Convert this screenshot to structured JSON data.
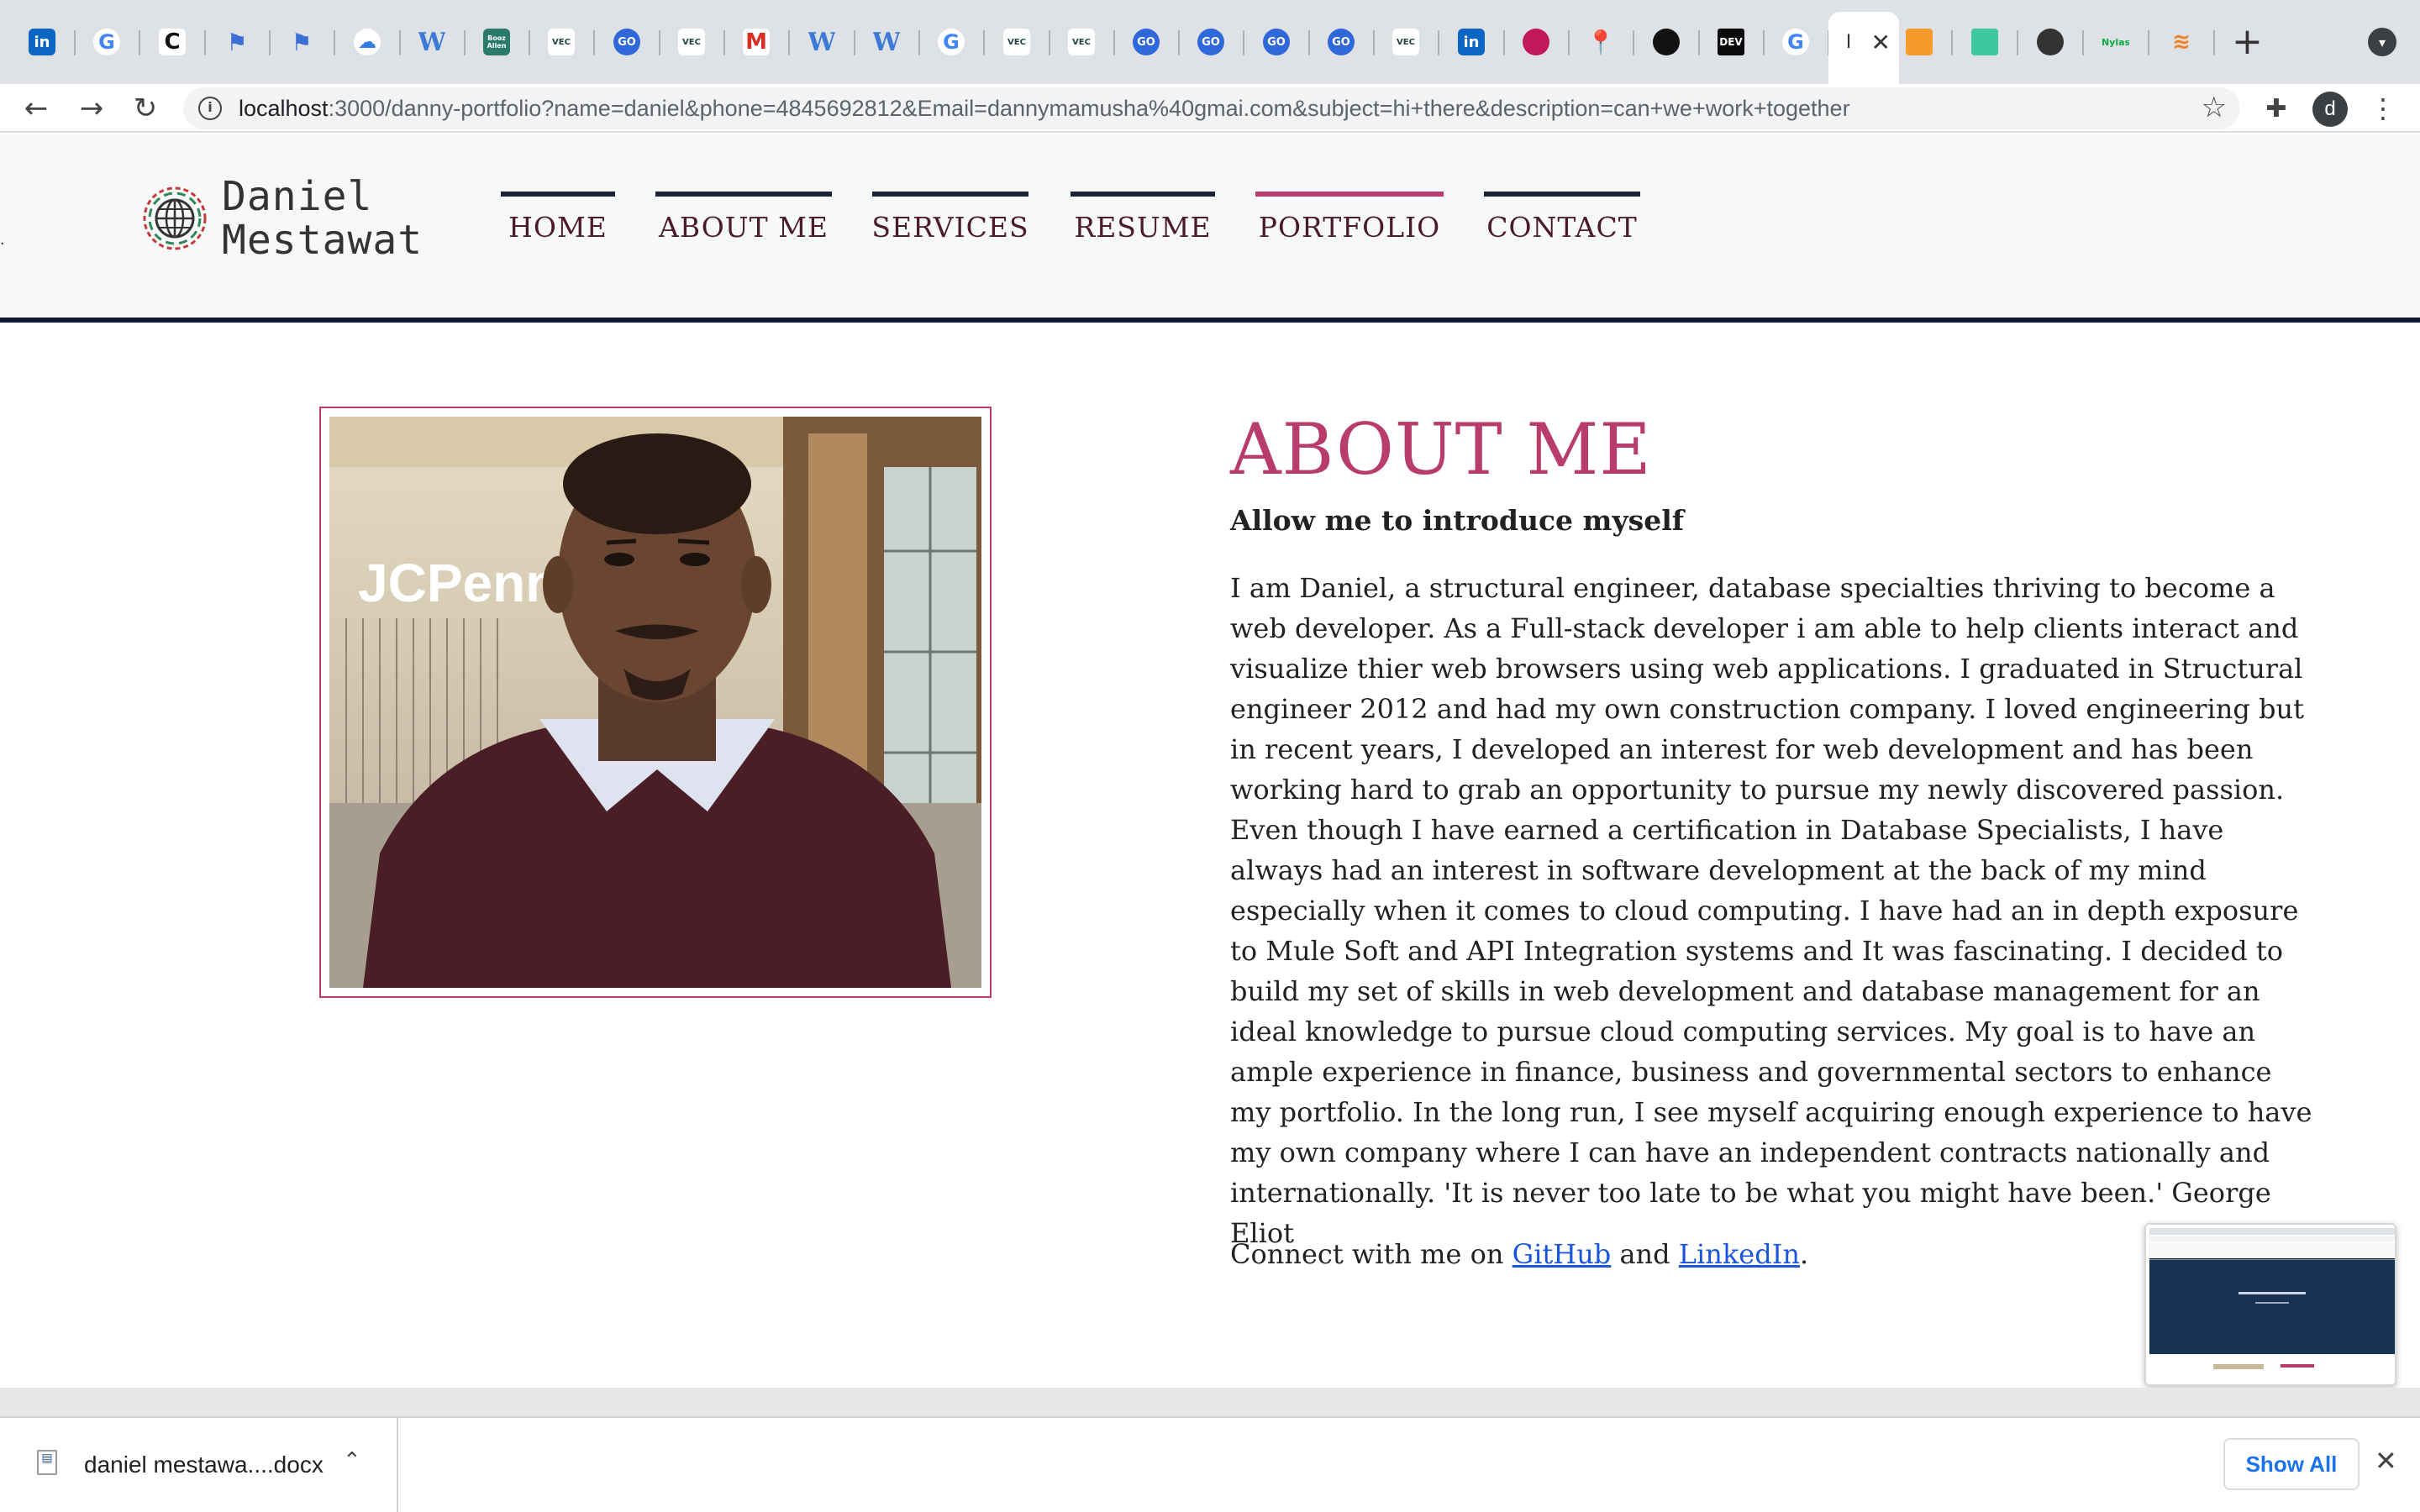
{
  "browser": {
    "tabs": [
      {
        "icon": "linkedin-icon",
        "glyph": "in",
        "cls": "linkedin"
      },
      {
        "icon": "google-icon",
        "glyph": "G",
        "cls": "google"
      },
      {
        "icon": "c-circle-icon",
        "glyph": "C",
        "cls": "ccircle"
      },
      {
        "icon": "flag-icon",
        "glyph": "⚑",
        "cls": "flag"
      },
      {
        "icon": "flag-icon",
        "glyph": "⚑",
        "cls": "flag"
      },
      {
        "icon": "cloud-icon",
        "glyph": "☁",
        "cls": "cloud"
      },
      {
        "icon": "w-icon",
        "glyph": "W",
        "cls": "w"
      },
      {
        "icon": "booz-allen-icon",
        "glyph": "Booz Allen",
        "cls": "booz"
      },
      {
        "icon": "vec-icon",
        "glyph": "VEC",
        "cls": "vec"
      },
      {
        "icon": "go-icon",
        "glyph": "GO",
        "cls": "go"
      },
      {
        "icon": "vec-icon",
        "glyph": "VEC",
        "cls": "vec"
      },
      {
        "icon": "gmail-icon",
        "glyph": "M",
        "cls": "gmail"
      },
      {
        "icon": "w-icon",
        "glyph": "W",
        "cls": "w"
      },
      {
        "icon": "w-icon",
        "glyph": "W",
        "cls": "w"
      },
      {
        "icon": "google-icon",
        "glyph": "G",
        "cls": "google"
      },
      {
        "icon": "vec-icon",
        "glyph": "VEC",
        "cls": "vec"
      },
      {
        "icon": "vec-icon",
        "glyph": "VEC",
        "cls": "vec"
      },
      {
        "icon": "go-icon",
        "glyph": "GO",
        "cls": "go"
      },
      {
        "icon": "go-icon",
        "glyph": "GO",
        "cls": "go"
      },
      {
        "icon": "go-icon",
        "glyph": "GO",
        "cls": "go"
      },
      {
        "icon": "go-icon",
        "glyph": "GO",
        "cls": "go"
      },
      {
        "icon": "vec-icon",
        "glyph": "VEC",
        "cls": "vec"
      },
      {
        "icon": "linkedin-icon",
        "glyph": "in",
        "cls": "linkedin"
      },
      {
        "icon": "hexagon-icon",
        "glyph": "",
        "cls": "pinkhex"
      },
      {
        "icon": "maps-pin-icon",
        "glyph": "📍",
        "cls": "maps"
      },
      {
        "icon": "github-icon",
        "glyph": "",
        "cls": "github"
      },
      {
        "icon": "dev-icon",
        "glyph": "DEV",
        "cls": "dev"
      },
      {
        "icon": "google-icon",
        "glyph": "G",
        "cls": "google"
      }
    ],
    "tabs_after": [
      {
        "icon": "orange-shield-icon",
        "glyph": "",
        "cls": "orange"
      },
      {
        "icon": "green-lines-icon",
        "glyph": "",
        "cls": "green"
      },
      {
        "icon": "globe-icon",
        "glyph": "",
        "cls": "globe"
      },
      {
        "icon": "nylas-icon",
        "glyph": "Nylas",
        "cls": "nylas"
      },
      {
        "icon": "stack-icon",
        "glyph": "≋",
        "cls": "stack"
      }
    ],
    "active_tab_glyph": "I",
    "url_host": "localhost",
    "url_rest": ":3000/danny-portfolio?name=daniel&phone=4845692812&Email=dannymamusha%40gmai.com&subject=hi+there&description=can+we+work+together",
    "profile_initial": "d"
  },
  "site": {
    "logo_line1": "Daniel",
    "logo_line2": "Mestawat",
    "nav": [
      {
        "label": "HOME"
      },
      {
        "label": "ABOUT ME"
      },
      {
        "label": "SERVICES"
      },
      {
        "label": "RESUME"
      },
      {
        "label": "PORTFOLIO",
        "active": true
      },
      {
        "label": "CONTACT"
      }
    ],
    "accent_color": "#b83c6c",
    "nav_dark_color": "#1b2436"
  },
  "about": {
    "title": "ABOUT ME",
    "subtitle": "Allow me to introduce myself",
    "body": "I am Daniel, a structural engineer, database specialties thriving to become a web developer. As a Full-stack developer i am able to help clients interact and visualize thier web browsers using web applications. I graduated in Structural engineer 2012 and had my own construction company. I loved engineering but in recent years, I developed an interest for web development and has been working hard to grab an opportunity to pursue my newly discovered passion. Even though I have earned a certification in Database Specialists, I have always had an interest in software development at the back of my mind especially when it comes to cloud computing. I have had an in depth exposure to Mule Soft and API Integration systems and It was fascinating. I decided to build my set of skills in web development and database management for an ideal knowledge to pursue cloud computing services. My goal is to have an ample experience in finance, business and governmental sectors to enhance my portfolio. In the long run, I see myself acquiring enough experience to have my own company where I can have an independent contracts nationally and internationally. 'It is never too late to be what you might have been.' George Eliot",
    "connect_prefix": "Connect with me on ",
    "github_link": "GitHub",
    "connect_and": " and ",
    "linkedin_link": "LinkedIn",
    "connect_suffix": ".",
    "photo_store_sign": "JCPenn"
  },
  "downloads": {
    "file_name": "daniel mestawa....docx",
    "show_all": "Show All"
  }
}
